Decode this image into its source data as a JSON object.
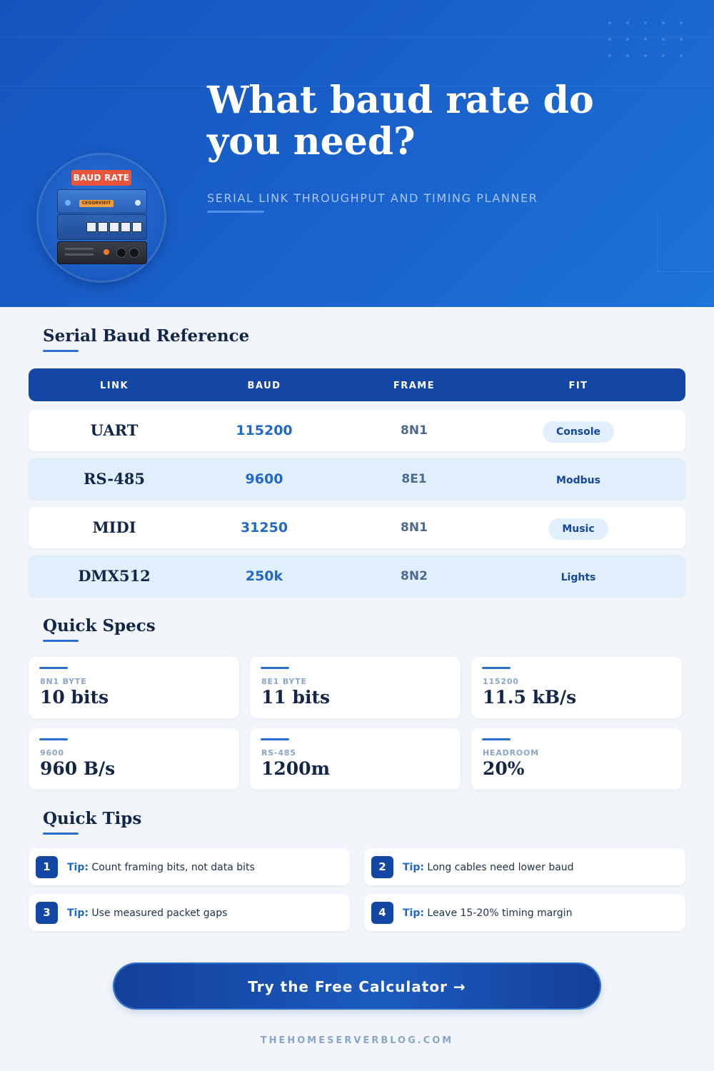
{
  "hero": {
    "title": "What baud rate do you need?",
    "subtitle": "SERIAL LINK THROUGHPUT AND TIMING PLANNER",
    "badge_label": "BAUD RATE",
    "device_tag": "CEGORVIEIT"
  },
  "reference": {
    "title": "Serial Baud Reference",
    "columns": [
      "LINK",
      "BAUD",
      "FRAME",
      "FIT"
    ],
    "rows": [
      {
        "link": "UART",
        "baud": "115200",
        "frame": "8N1",
        "fit": "Console"
      },
      {
        "link": "RS-485",
        "baud": "9600",
        "frame": "8E1",
        "fit": "Modbus"
      },
      {
        "link": "MIDI",
        "baud": "31250",
        "frame": "8N1",
        "fit": "Music"
      },
      {
        "link": "DMX512",
        "baud": "250k",
        "frame": "8N2",
        "fit": "Lights"
      }
    ]
  },
  "specs": {
    "title": "Quick Specs",
    "cards": [
      {
        "label": "8N1 BYTE",
        "value": "10 bits"
      },
      {
        "label": "8E1 BYTE",
        "value": "11 bits"
      },
      {
        "label": "115200",
        "value": "11.5 kB/s"
      },
      {
        "label": "9600",
        "value": "960 B/s"
      },
      {
        "label": "RS-485",
        "value": "1200m"
      },
      {
        "label": "HEADROOM",
        "value": "20%"
      }
    ]
  },
  "tips": {
    "title": "Quick Tips",
    "prefix": "Tip:",
    "items": [
      {
        "num": "1",
        "text": "Count framing bits, not data bits"
      },
      {
        "num": "2",
        "text": "Long cables need lower baud"
      },
      {
        "num": "3",
        "text": "Use measured packet gaps"
      },
      {
        "num": "4",
        "text": "Leave 15-20% timing margin"
      }
    ]
  },
  "cta": {
    "label": "Try the Free Calculator →"
  },
  "footer": {
    "site": "THEHOMESERVERBLOG.COM"
  },
  "colors": {
    "primary": "#1446a3",
    "accent": "#2168c8",
    "heading": "#13264a",
    "badge": "#e8553c"
  }
}
